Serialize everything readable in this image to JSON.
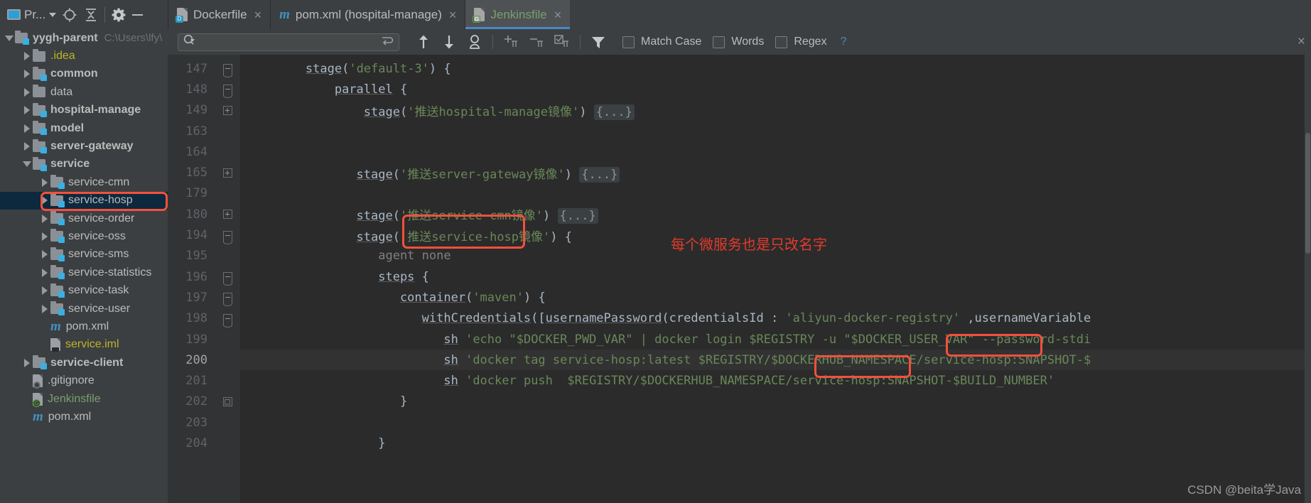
{
  "toolbar": {
    "project_label": "Pr...",
    "icons": [
      "project-view-icon",
      "locate-icon",
      "collapse-all-icon",
      "settings-gear-icon",
      "minimize-icon"
    ]
  },
  "tabs": [
    {
      "name": "Dockerfile",
      "icon": "dockerfile-icon",
      "badge": "D",
      "active": false,
      "close": "×"
    },
    {
      "name": "pom.xml (hospital-manage)",
      "icon": "maven-icon",
      "badge": "m",
      "active": false,
      "close": "×"
    },
    {
      "name": "Jenkinsfile",
      "icon": "groovy-file-icon",
      "badge": "G",
      "active": true,
      "close": "×"
    }
  ],
  "project_tree": {
    "root": {
      "label": "yygh-parent",
      "path": "C:\\Users\\lfy\\"
    },
    "items": [
      {
        "label": ".idea",
        "indent": 1,
        "arrow": "right",
        "icon": "folder-icon",
        "style": "yellow"
      },
      {
        "label": "common",
        "indent": 1,
        "arrow": "right",
        "icon": "module-folder-icon",
        "style": "bold"
      },
      {
        "label": "data",
        "indent": 1,
        "arrow": "right",
        "icon": "folder-icon",
        "style": "grey"
      },
      {
        "label": "hospital-manage",
        "indent": 1,
        "arrow": "right",
        "icon": "module-folder-icon",
        "style": "bold"
      },
      {
        "label": "model",
        "indent": 1,
        "arrow": "right",
        "icon": "module-folder-icon",
        "style": "bold"
      },
      {
        "label": "server-gateway",
        "indent": 1,
        "arrow": "right",
        "icon": "module-folder-icon",
        "style": "bold"
      },
      {
        "label": "service",
        "indent": 1,
        "arrow": "down",
        "icon": "module-folder-icon",
        "style": "bold"
      },
      {
        "label": "service-cmn",
        "indent": 2,
        "arrow": "right",
        "icon": "module-folder-icon",
        "style": "grey"
      },
      {
        "label": "service-hosp",
        "indent": 2,
        "arrow": "right",
        "icon": "module-folder-icon",
        "style": "grey",
        "selected": true,
        "highlighted": true
      },
      {
        "label": "service-order",
        "indent": 2,
        "arrow": "right",
        "icon": "module-folder-icon",
        "style": "grey"
      },
      {
        "label": "service-oss",
        "indent": 2,
        "arrow": "right",
        "icon": "module-folder-icon",
        "style": "grey"
      },
      {
        "label": "service-sms",
        "indent": 2,
        "arrow": "right",
        "icon": "module-folder-icon",
        "style": "grey"
      },
      {
        "label": "service-statistics",
        "indent": 2,
        "arrow": "right",
        "icon": "module-folder-icon",
        "style": "grey"
      },
      {
        "label": "service-task",
        "indent": 2,
        "arrow": "right",
        "icon": "module-folder-icon",
        "style": "grey"
      },
      {
        "label": "service-user",
        "indent": 2,
        "arrow": "right",
        "icon": "module-folder-icon",
        "style": "grey"
      },
      {
        "label": "pom.xml",
        "indent": 2,
        "arrow": "none",
        "icon": "maven-icon",
        "style": "grey"
      },
      {
        "label": "service.iml",
        "indent": 2,
        "arrow": "none",
        "icon": "iml-file-icon",
        "style": "yellow"
      },
      {
        "label": "service-client",
        "indent": 1,
        "arrow": "right",
        "icon": "module-folder-icon",
        "style": "bold"
      },
      {
        "label": ".gitignore",
        "indent": 1,
        "arrow": "none",
        "icon": "gitignore-file-icon",
        "style": "grey"
      },
      {
        "label": "Jenkinsfile",
        "indent": 1,
        "arrow": "none",
        "icon": "groovy-file-icon",
        "style": "green"
      },
      {
        "label": "pom.xml",
        "indent": 1,
        "arrow": "none",
        "icon": "maven-icon",
        "style": "grey"
      }
    ]
  },
  "find_bar": {
    "search_value": "",
    "search_placeholder": "",
    "icons": [
      "search-icon",
      "regex-wrap-icon",
      "prev-occurrence-icon",
      "next-occurrence-icon",
      "select-all-occurrences-icon",
      "add-selection-icon",
      "remove-selection-icon",
      "select-all-icon",
      "filter-icon"
    ],
    "checkboxes": [
      {
        "label": "Match Case",
        "checked": false
      },
      {
        "label": "Words",
        "checked": false
      },
      {
        "label": "Regex",
        "checked": false
      }
    ],
    "help_label": "?"
  },
  "editor": {
    "current_line": 200,
    "lines": [
      {
        "num": "147",
        "fold": "collapse-end",
        "indent": 8,
        "segments": [
          {
            "t": "stage",
            "c": "fn"
          },
          {
            "t": "(",
            "c": "def"
          },
          {
            "t": "'default-3'",
            "c": "str"
          },
          {
            "t": ") {",
            "c": "def"
          }
        ]
      },
      {
        "num": "148",
        "fold": "collapse-end",
        "indent": 12,
        "segments": [
          {
            "t": "parallel",
            "c": "fn"
          },
          {
            "t": " {",
            "c": "def"
          }
        ]
      },
      {
        "num": "149",
        "fold": "expand",
        "indent": 16,
        "segments": [
          {
            "t": "stage",
            "c": "fn"
          },
          {
            "t": "(",
            "c": "def"
          },
          {
            "t": "'推送hospital-manage镜像'",
            "c": "str"
          },
          {
            "t": ") ",
            "c": "def"
          },
          {
            "t": "{...}",
            "c": "fold"
          }
        ]
      },
      {
        "num": "163",
        "fold": "none",
        "indent": 0,
        "segments": []
      },
      {
        "num": "164",
        "fold": "none",
        "indent": 0,
        "segments": []
      },
      {
        "num": "165",
        "fold": "expand",
        "indent": 15,
        "segments": [
          {
            "t": "stage",
            "c": "fn"
          },
          {
            "t": "(",
            "c": "def"
          },
          {
            "t": "'推送server-gateway镜像'",
            "c": "str"
          },
          {
            "t": ") ",
            "c": "def"
          },
          {
            "t": "{...}",
            "c": "fold"
          }
        ]
      },
      {
        "num": "179",
        "fold": "none",
        "indent": 0,
        "segments": []
      },
      {
        "num": "180",
        "fold": "expand",
        "indent": 15,
        "segments": [
          {
            "t": "stage",
            "c": "fn"
          },
          {
            "t": "(",
            "c": "def"
          },
          {
            "t": "'推送service-cmn镜像'",
            "c": "str"
          },
          {
            "t": ") ",
            "c": "def"
          },
          {
            "t": "{...}",
            "c": "fold"
          }
        ]
      },
      {
        "num": "194",
        "fold": "collapse-end",
        "indent": 15,
        "segments": [
          {
            "t": "stage",
            "c": "fn"
          },
          {
            "t": "(",
            "c": "def"
          },
          {
            "t": "'推送service-hosp镜像'",
            "c": "str"
          },
          {
            "t": ") {",
            "c": "def"
          }
        ]
      },
      {
        "num": "195",
        "fold": "none",
        "indent": 18,
        "segments": [
          {
            "t": "agent none",
            "c": "dim"
          }
        ]
      },
      {
        "num": "196",
        "fold": "collapse-end",
        "indent": 18,
        "segments": [
          {
            "t": "steps",
            "c": "fn"
          },
          {
            "t": " {",
            "c": "def"
          }
        ]
      },
      {
        "num": "197",
        "fold": "collapse-end",
        "indent": 21,
        "segments": [
          {
            "t": "container",
            "c": "fn"
          },
          {
            "t": "(",
            "c": "def"
          },
          {
            "t": "'maven'",
            "c": "str"
          },
          {
            "t": ") {",
            "c": "def"
          }
        ]
      },
      {
        "num": "198",
        "fold": "collapse-end",
        "indent": 24,
        "segments": [
          {
            "t": "withCredentials",
            "c": "fn"
          },
          {
            "t": "([",
            "c": "def"
          },
          {
            "t": "usernamePassword",
            "c": "fn"
          },
          {
            "t": "(credentialsId : ",
            "c": "def"
          },
          {
            "t": "'aliyun-docker-registry'",
            "c": "str"
          },
          {
            "t": " ,usernameVariable",
            "c": "def"
          }
        ]
      },
      {
        "num": "199",
        "fold": "none",
        "indent": 27,
        "segments": [
          {
            "t": "sh",
            "c": "fn"
          },
          {
            "t": " ",
            "c": "def"
          },
          {
            "t": "'echo \"$DOCKER_PWD_VAR\" | docker login $REGISTRY -u \"$DOCKER_USER_VAR\" --password-stdi",
            "c": "str"
          }
        ]
      },
      {
        "num": "200",
        "fold": "none",
        "indent": 27,
        "current": true,
        "segments": [
          {
            "t": "sh",
            "c": "fn"
          },
          {
            "t": " ",
            "c": "def"
          },
          {
            "t": "'docker tag service-hosp:latest $REGISTRY/$DOCKERHUB_NAMESPACE/service-hosp:SNAPSHOT-$",
            "c": "str"
          }
        ]
      },
      {
        "num": "201",
        "fold": "none",
        "indent": 27,
        "segments": [
          {
            "t": "sh",
            "c": "fn"
          },
          {
            "t": " ",
            "c": "def"
          },
          {
            "t": "'docker push  $REGISTRY/$DOCKERHUB_NAMESPACE/service-hosp:SNAPSHOT-$BUILD_NUMBER'",
            "c": "str"
          }
        ]
      },
      {
        "num": "202",
        "fold": "collapse-start",
        "indent": 21,
        "segments": [
          {
            "t": "}",
            "c": "def"
          }
        ]
      },
      {
        "num": "203",
        "fold": "none",
        "indent": 0,
        "segments": []
      },
      {
        "num": "204",
        "fold": "none",
        "indent": 18,
        "segments": [
          {
            "t": "}",
            "c": "def"
          }
        ]
      }
    ]
  },
  "annotation": {
    "text": "每个微服务也是只改名字",
    "color": "#e23b2c"
  },
  "watermark": {
    "text": "CSDN @beita学Java"
  },
  "colors": {
    "highlight_box": "#f4503c",
    "selection": "#0d293e",
    "tab_active_underline": "#4a88c7",
    "editor_bg": "#2b2b2b",
    "panel_bg": "#3c3f41",
    "string_green": "#6a8759"
  }
}
